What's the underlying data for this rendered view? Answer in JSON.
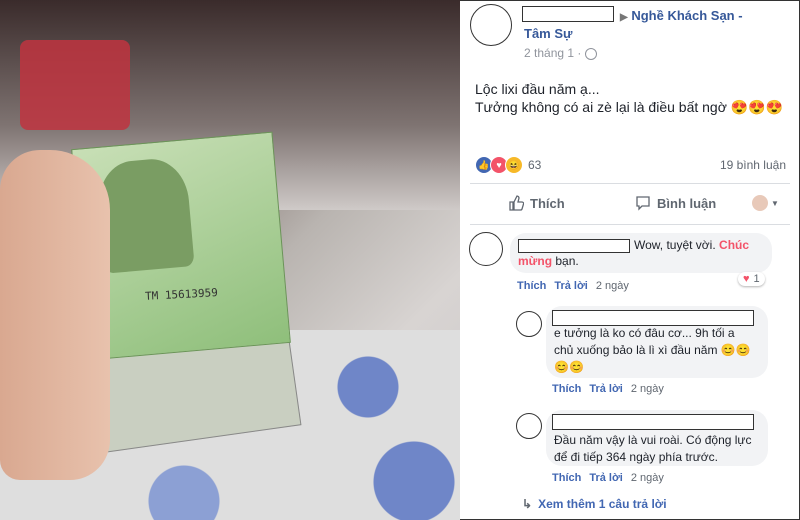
{
  "post": {
    "group_line1": "Nghề Khách Sạn -",
    "group_line2": "Tâm Sự",
    "time": "2 tháng 1 ·",
    "text_line1": "Lộc lixi đầu năm ạ...",
    "text_line2": "Tưởng không có ai zè lại là điều bất ngờ 😍😍😍",
    "reaction_count": "63",
    "comment_count": "19 bình luận",
    "like_label": "Thích",
    "comment_label": "Bình luận"
  },
  "banknote_serial": "TM 15613959",
  "comments": [
    {
      "text": "Wow, tuyệt vời.",
      "highlight": "Chúc mừng",
      "text_end": "bạn.",
      "like": "Thích",
      "reply": "Trả lời",
      "time": "2 ngày",
      "reaction_count": "1"
    },
    {
      "text_line1": "e tưởng là ko có đâu cơ... 9h tối a",
      "text_line2": "chủ xuống bảo là lì xì đầu năm 😊😊",
      "text_line3": "😊😊",
      "like": "Thích",
      "reply": "Trả lời",
      "time": "2 ngày"
    },
    {
      "text_line1": "Đầu năm vậy là vui roài. Có động lực",
      "text_line2": "để đi tiếp 364 ngày phía trước.",
      "like": "Thích",
      "reply": "Trả lời",
      "time": "2 ngày"
    }
  ],
  "see_more": "Xem thêm 1 câu trả lời",
  "colors": {
    "link": "#365899",
    "accent": "#4267b2",
    "highlight": "#f35369"
  }
}
